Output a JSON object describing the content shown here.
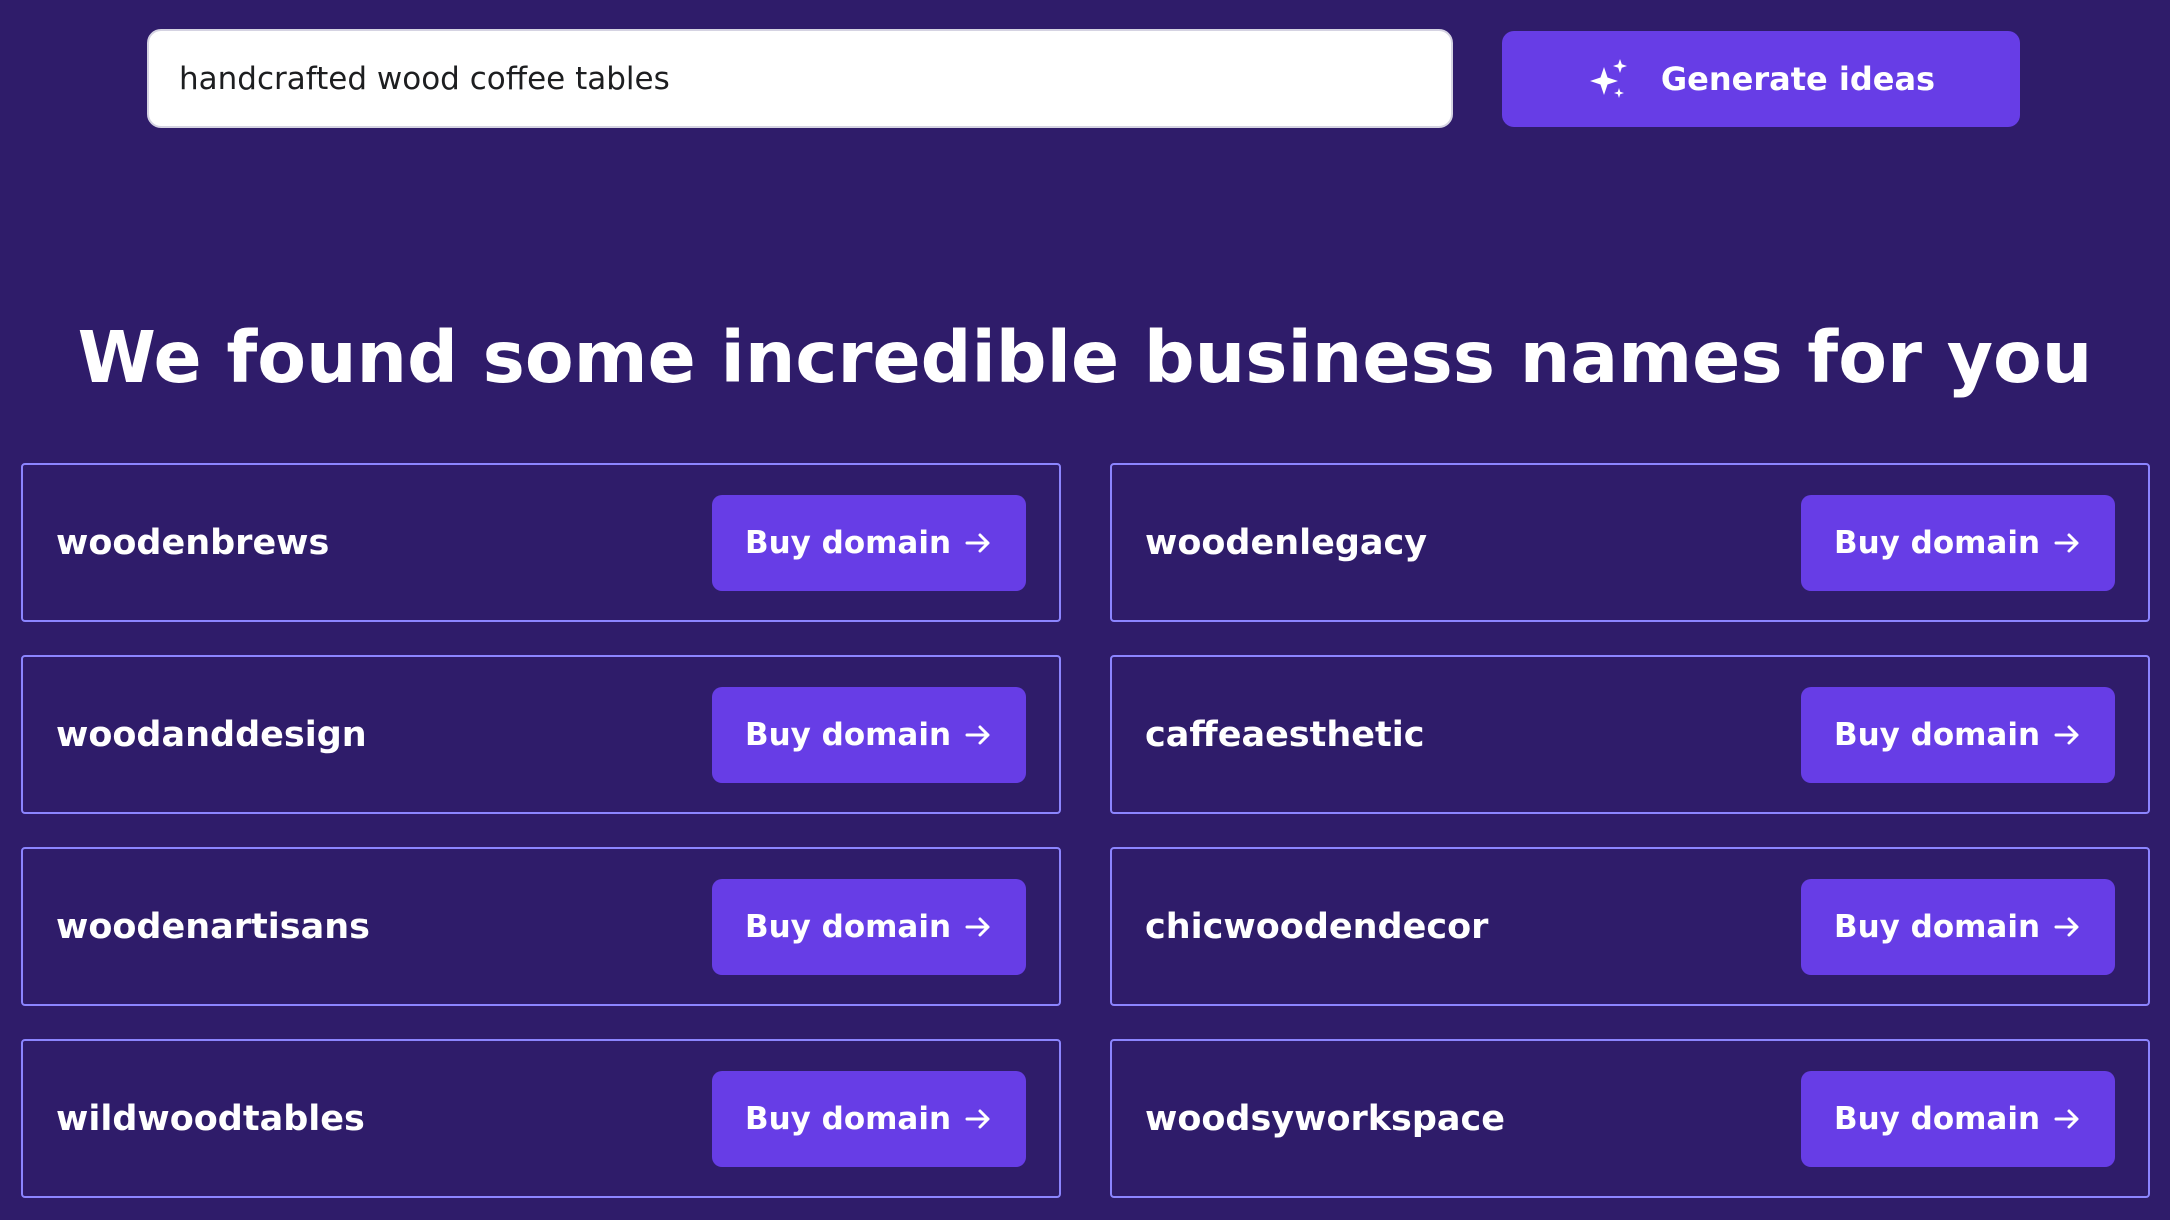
{
  "search": {
    "value": "handcrafted wood coffee tables",
    "placeholder": ""
  },
  "generate_button": {
    "label": "Generate ideas",
    "icon": "sparkle-icon"
  },
  "heading": "We found some incredible business names for you",
  "results": [
    {
      "name": "woodenbrews",
      "button_label": "Buy domain"
    },
    {
      "name": "woodenlegacy",
      "button_label": "Buy domain"
    },
    {
      "name": "woodanddesign",
      "button_label": "Buy domain"
    },
    {
      "name": "caffeaesthetic",
      "button_label": "Buy domain"
    },
    {
      "name": "woodenartisans",
      "button_label": "Buy domain"
    },
    {
      "name": "chicwoodendecor",
      "button_label": "Buy domain"
    },
    {
      "name": "wildwoodtables",
      "button_label": "Buy domain"
    },
    {
      "name": "woodsyworkspace",
      "button_label": "Buy domain"
    }
  ],
  "colors": {
    "background": "#2f1c6a",
    "accent": "#673de6",
    "card_border": "#8c85ff",
    "text": "#ffffff"
  }
}
